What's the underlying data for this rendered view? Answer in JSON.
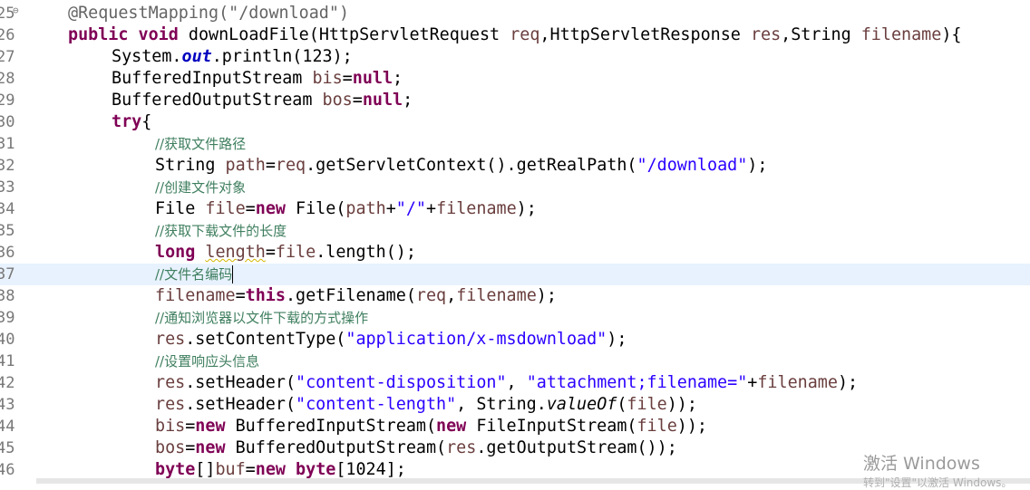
{
  "editor": {
    "lines": [
      {
        "num": "25",
        "code": "@RequestMapping(\"/download\")"
      },
      {
        "num": "26",
        "code": "public void downLoadFile(HttpServletRequest req,HttpServletResponse res,String filename){"
      },
      {
        "num": "27",
        "code": "System.out.println(123);"
      },
      {
        "num": "28",
        "code": "BufferedInputStream bis=null;"
      },
      {
        "num": "29",
        "code": "BufferedOutputStream bos=null;"
      },
      {
        "num": "30",
        "code": "try{"
      },
      {
        "num": "31",
        "code": "//获取文件路径"
      },
      {
        "num": "32",
        "code": "String path=req.getServletContext().getRealPath(\"/download\");"
      },
      {
        "num": "33",
        "code": "//创建文件对象"
      },
      {
        "num": "34",
        "code": "File file=new File(path+\"/\"+filename);"
      },
      {
        "num": "35",
        "code": "//获取下载文件的长度"
      },
      {
        "num": "36",
        "code": "long length=file.length();"
      },
      {
        "num": "37",
        "code": "//文件名编码"
      },
      {
        "num": "38",
        "code": "filename=this.getFilename(req,filename);"
      },
      {
        "num": "39",
        "code": "//通知浏览器以文件下载的方式操作"
      },
      {
        "num": "40",
        "code": "res.setContentType(\"application/x-msdownload\");"
      },
      {
        "num": "41",
        "code": "//设置响应头信息"
      },
      {
        "num": "42",
        "code": "res.setHeader(\"content-disposition\", \"attachment;filename=\"+filename);"
      },
      {
        "num": "43",
        "code": "res.setHeader(\"content-length\", String.valueOf(file));"
      },
      {
        "num": "44",
        "code": "bis=new BufferedInputStream(new FileInputStream(file));"
      },
      {
        "num": "45",
        "code": "bos=new BufferedOutputStream(res.getOutputStream());"
      },
      {
        "num": "46",
        "code": "byte[]buf=new byte[1024];"
      }
    ],
    "gutter_display": [
      "25",
      "26",
      "27",
      "28",
      "29",
      "30",
      "31",
      "32",
      "33",
      "34",
      "35",
      "36",
      "37",
      "38",
      "39",
      "40",
      "41",
      "42",
      "43",
      "44",
      "45",
      "46"
    ],
    "current_line": "37"
  },
  "watermark": {
    "title": "激活 Windows",
    "subtitle": "转到\"设置\"以激活 Windows。"
  },
  "colors": {
    "keyword": "#7f0055",
    "string": "#2a00ff",
    "variable": "#6a3e3e",
    "comment": "#3f7f5f",
    "current_line_bg": "#e8f2fe"
  }
}
